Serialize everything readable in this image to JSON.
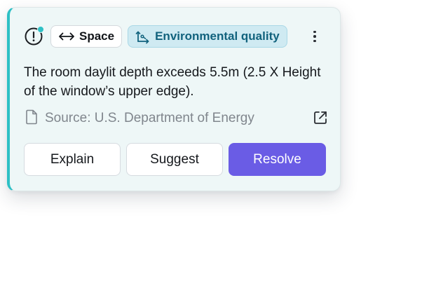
{
  "card": {
    "tags": {
      "space_label": "Space",
      "category_label": "Environmental quality"
    },
    "icons": {
      "status": "alert-circle-icon",
      "space": "horizontal-arrows-icon",
      "category": "axes-flow-icon",
      "more": "more-vertical-icon",
      "source": "document-icon",
      "external": "external-link-icon"
    },
    "status_dot_color": "#2ec0c5",
    "accent_color": "#2ec0c5",
    "description": "The room daylit depth exceeds 5.5m (2.5 X Height of the window’s upper edge).",
    "source_text": "Source: U.S. Department of Energy",
    "actions": {
      "explain_label": "Explain",
      "suggest_label": "Suggest",
      "resolve_label": "Resolve"
    },
    "primary_color": "#6a5ce5"
  }
}
